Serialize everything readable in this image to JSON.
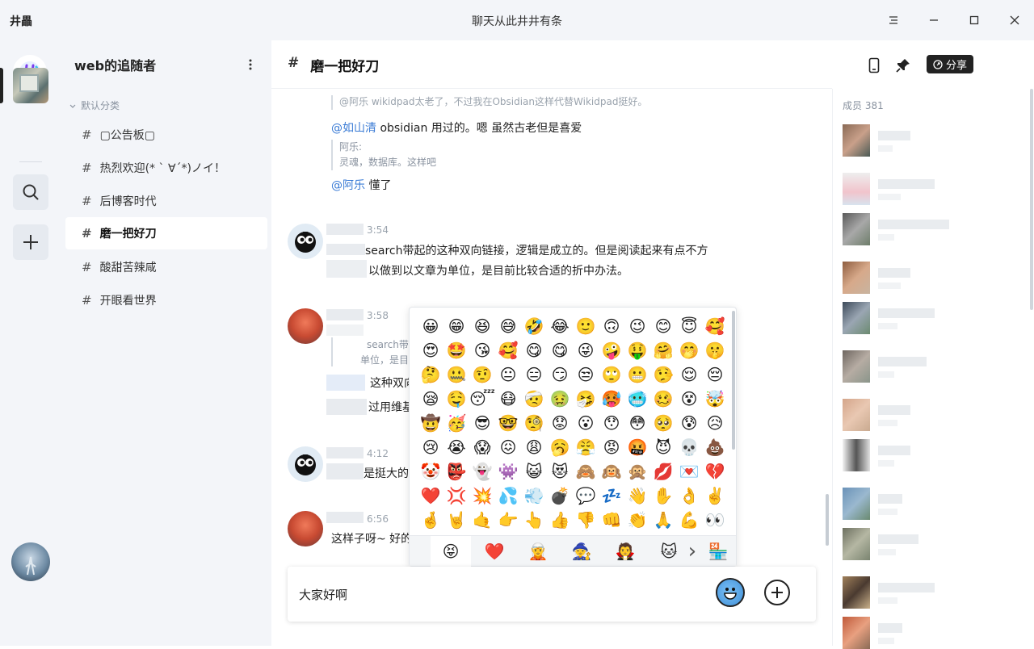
{
  "window": {
    "app_name": "井畾",
    "title": "聊天从此井井有条"
  },
  "guild": {
    "name": "web的追随者",
    "category": "默认分类",
    "channels": [
      {
        "name": "▢公告板▢"
      },
      {
        "name": "热烈欢迎(* ` ∀´*)ノイ！"
      },
      {
        "name": "后博客时代"
      },
      {
        "name": "磨一把好刀"
      },
      {
        "name": "酸甜苦辣咸"
      },
      {
        "name": "开眼看世界"
      }
    ],
    "active_channel": "磨一把好刀"
  },
  "header": {
    "channel_title": "磨一把好刀",
    "share_label": "分享"
  },
  "messages": {
    "top_quote": "@阿乐 wikidpad太老了，不过我在Obsidian这样代替Wikidpad挺好。",
    "m1_mention": "@如山清",
    "m1_text": " obsidian 用过的。嗯 虽然古老但是喜爱",
    "m1_quote_author": "阿乐:",
    "m1_quote_text": "灵魂，数据库。这样吧",
    "m2_mention": "@阿乐",
    "m2_text": " 懂了",
    "m3_time": "3:54",
    "m3_line1": "search带起的这种双向链接，逻辑是成立的。但是阅读起来有点不方",
    "m3_line2": "以做到以文章为单位，是目前比较合适的折中办法。",
    "m4_time": "3:58",
    "m4_quote1": "search带起",
    "m4_quote2": "单位，是目",
    "m4_line1": "这种双向",
    "m4_line2": "过用维基",
    "m5_time": "4:12",
    "m5_text": "是挺大的",
    "m6_time": "6:56",
    "m6_text": "这样子呀~ 好的"
  },
  "composer": {
    "value": "大家好啊"
  },
  "emoji_picker": {
    "emojis": [
      "😀",
      "😁",
      "😆",
      "😅",
      "🤣",
      "😂",
      "🙂",
      "🙃",
      "😉",
      "😊",
      "😇",
      "🥰",
      "😍",
      "🤩",
      "😘",
      "🥰",
      "😋",
      "😋",
      "😜",
      "🤪",
      "🤑",
      "🤗",
      "🤭",
      "🤫",
      "🤔",
      "🤐",
      "🤨",
      "😐",
      "😑",
      "😏",
      "😒",
      "🙄",
      "😬",
      "🤥",
      "😌",
      "😔",
      "😪",
      "🤤",
      "😴",
      "😷",
      "🤕",
      "🤢",
      "🤧",
      "🥵",
      "🥶",
      "🥴",
      "😵",
      "🤯",
      "🤠",
      "🥳",
      "😎",
      "🤓",
      "🧐",
      "😟",
      "😮",
      "😯",
      "😳",
      "🥺",
      "😰",
      "😥",
      "😢",
      "😭",
      "😱",
      "😖",
      "😩",
      "🥱",
      "😤",
      "😡",
      "🤬",
      "😈",
      "💀",
      "💩",
      "🤡",
      "👺",
      "👻",
      "👾",
      "😺",
      "😻",
      "🙈",
      "🙉",
      "🙊",
      "💋",
      "💌",
      "💔",
      "❤️",
      "💢",
      "💥",
      "💦",
      "💨",
      "💣",
      "💬",
      "💤",
      "👋",
      "✋",
      "👌",
      "✌️",
      "🤞",
      "🤘",
      "🤙",
      "👉",
      "👆",
      "👍",
      "👎",
      "👊",
      "👏",
      "🙏",
      "💪",
      "👀"
    ],
    "tabs": [
      "😝",
      "❤️",
      "🧝",
      "🧙",
      "🧛",
      "🐱",
      "›",
      "🏪"
    ]
  },
  "members": {
    "label": "成员",
    "count": "381"
  }
}
